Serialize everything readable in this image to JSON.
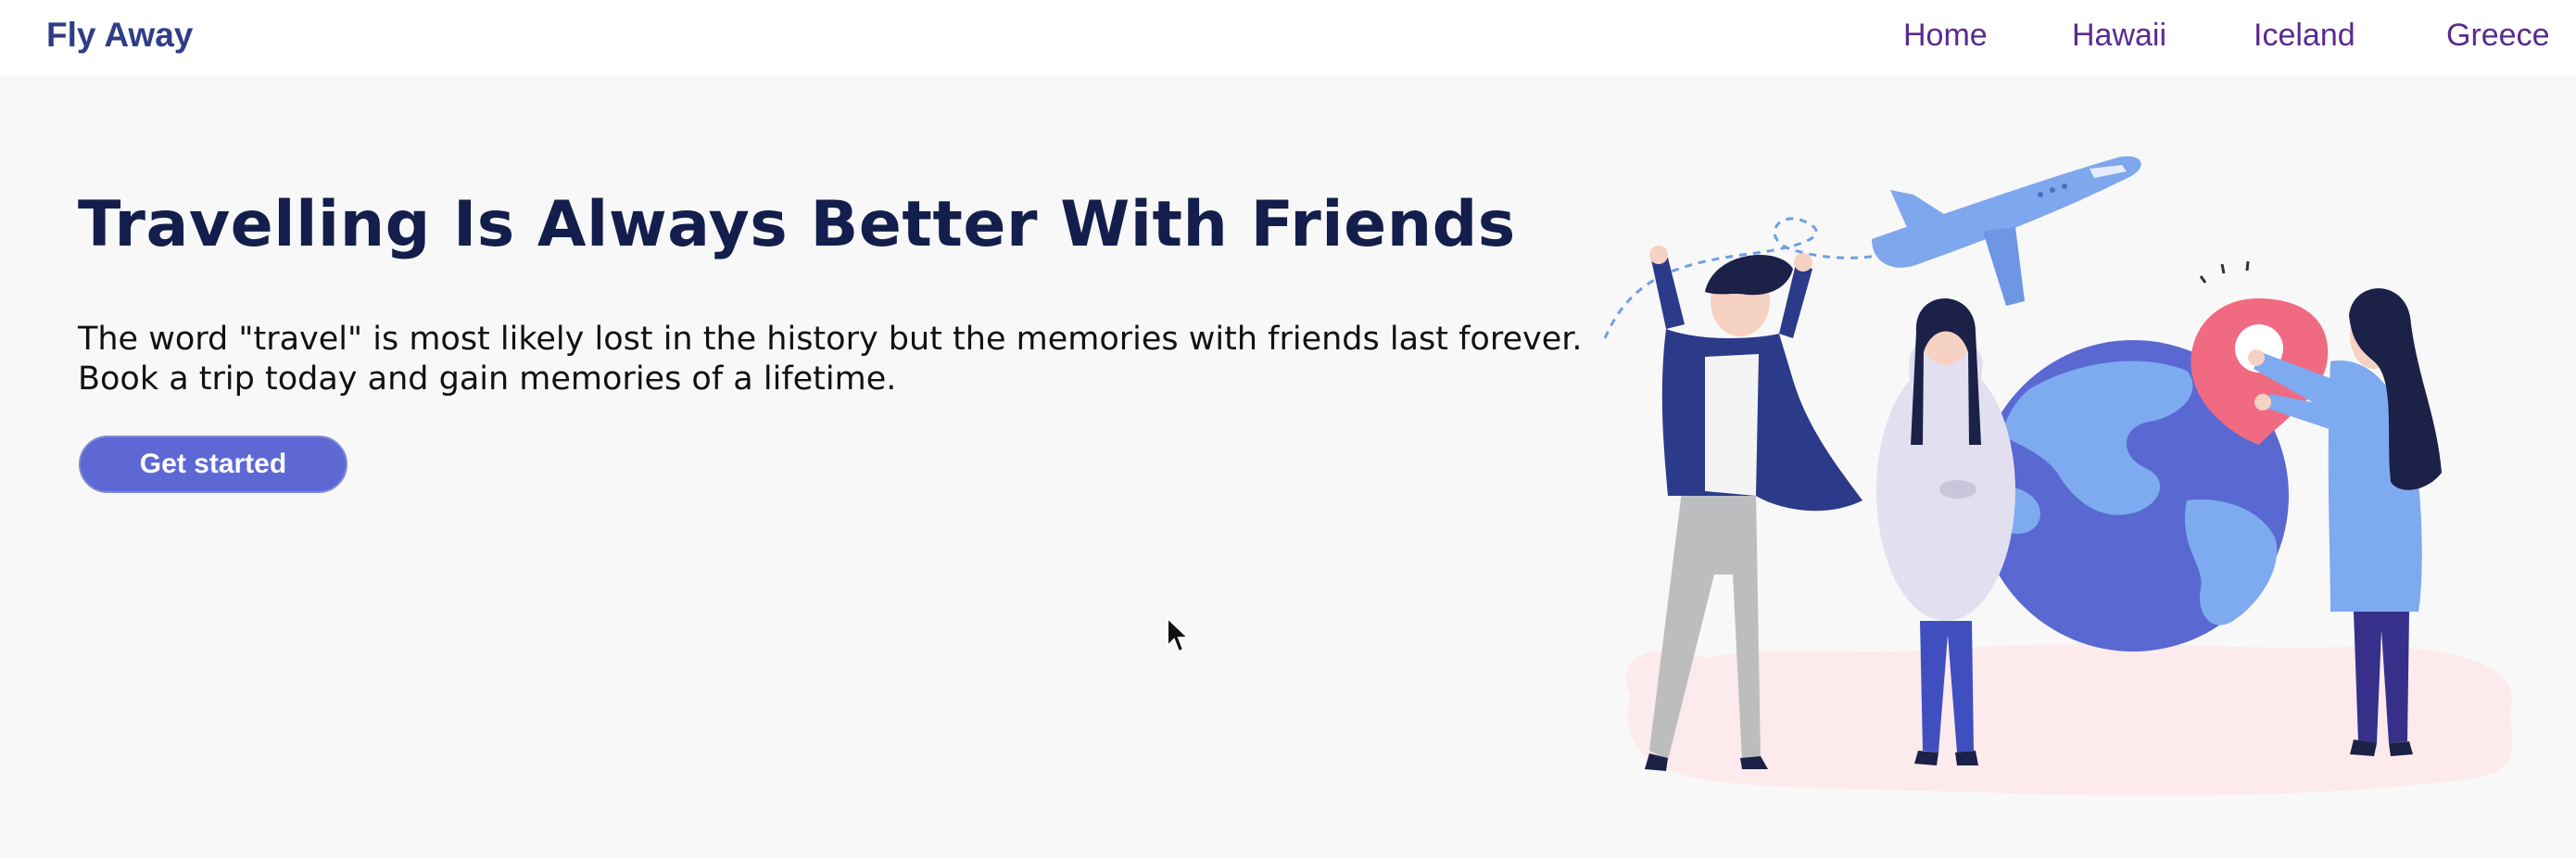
{
  "header": {
    "brand": "Fly Away",
    "nav": [
      {
        "label": "Home"
      },
      {
        "label": "Hawaii"
      },
      {
        "label": "Iceland"
      },
      {
        "label": "Greece"
      }
    ]
  },
  "hero": {
    "title": "Travelling Is Always Better With Friends",
    "description": "The word \"travel\" is most likely lost in the history but the memories with friends last forever. Book a trip today and gain memories of a lifetime.",
    "cta_label": "Get started"
  },
  "colors": {
    "brand": "#2f3d86",
    "nav_link": "#5a2a8e",
    "title": "#141e4c",
    "button": "#5d68d4",
    "background": "#f8f8f8"
  },
  "icons": {
    "illustration": "travel-friends-illustration",
    "cursor": "mouse-cursor-icon"
  }
}
